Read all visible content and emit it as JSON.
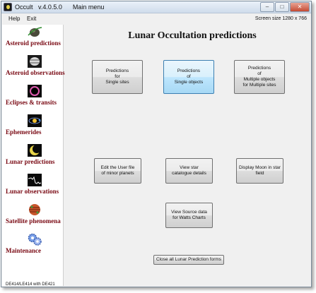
{
  "window": {
    "title": "Occult   v.4.0.5.0      Main menu",
    "controls": {
      "minimize": "–",
      "maximize": "□",
      "close": "✕"
    }
  },
  "menu": {
    "items": [
      "Help",
      "Exit"
    ],
    "screen_size": "Screen size 1280 x 766"
  },
  "sidebar": {
    "items": [
      {
        "label": "Asteroid predictions",
        "icon": "asteroid-icon"
      },
      {
        "label": "Asteroid observations",
        "icon": "asteroid-observation-icon"
      },
      {
        "label": "Eclipses & transits",
        "icon": "eclipse-icon"
      },
      {
        "label": "Ephemerides",
        "icon": "ephemeris-icon"
      },
      {
        "label": "Lunar predictions",
        "icon": "moon-icon"
      },
      {
        "label": "Lunar observations",
        "icon": "lightcurve-icon"
      },
      {
        "label": "Satellite phenomena",
        "icon": "jupiter-icon"
      },
      {
        "label": "Maintenance",
        "icon": "gears-icon"
      }
    ],
    "ephemeris": "DE414/LE414 with DE421"
  },
  "main": {
    "title": "Lunar Occultation predictions",
    "buttons": {
      "single_sites": "Predictions\nfor\nSingle sites",
      "single_objects": "Predictions\nof\nSingle objects",
      "multiple_objects": "Predictions\nof\nMultiple objects\nfor Multiple sites",
      "edit_user_file": "Edit the User file\nof minor planets",
      "star_catalogue": "View star\ncatalogue details",
      "display_moon": "Display Moon in star\nfield",
      "watts_charts": "View Source data\nfor Watts Charts",
      "close_all": "Close all Lunar Prediction forms"
    }
  }
}
